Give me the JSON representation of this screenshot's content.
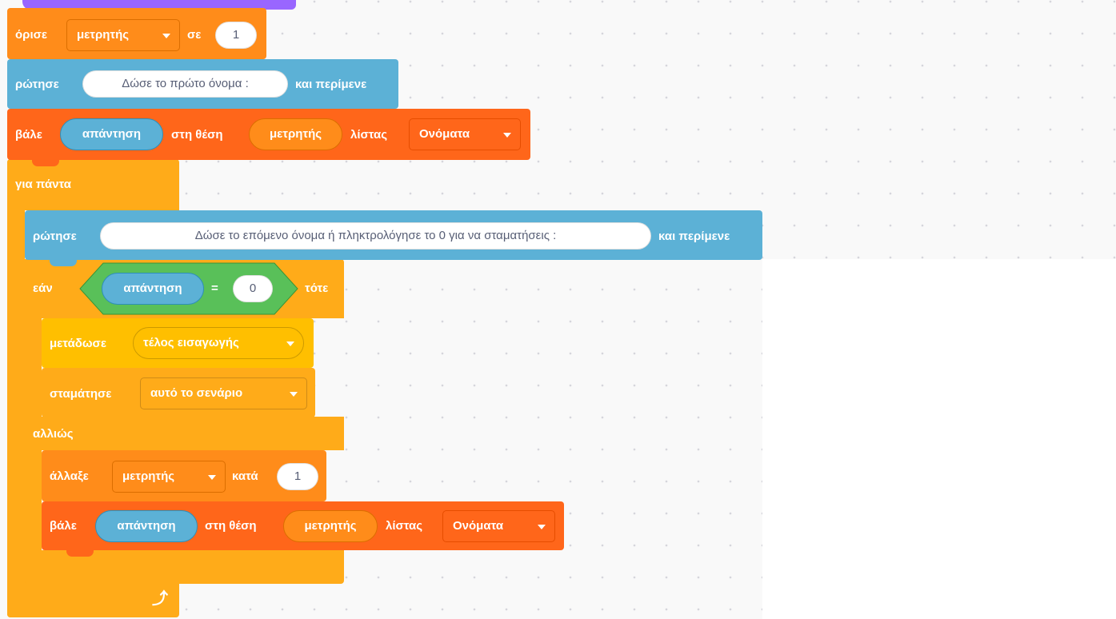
{
  "colors": {
    "variables": "#ff8c1a",
    "sensing": "#5cb1d6",
    "lists": "#ff661a",
    "control": "#ffab19",
    "events": "#ffbf00",
    "operators": "#59c059",
    "looks_hat": "#9966ff"
  },
  "set_block": {
    "label": "όρισε",
    "variable": "μετρητής",
    "to": "σε",
    "value": "1"
  },
  "ask1": {
    "label": "ρώτησε",
    "question": "Δώσε το πρώτο όνομα :",
    "suffix": "και περίμενε"
  },
  "insert1": {
    "label": "βάλε",
    "item": "απάντηση",
    "at": "στη θέση",
    "index": "μετρητής",
    "of_list": "λίστας",
    "list": "Ονόματα"
  },
  "forever": {
    "label": "για πάντα",
    "loop_icon": "loop-arrow-icon"
  },
  "ask2": {
    "label": "ρώτησε",
    "question": "Δώσε το επόμενο όνομα ή πληκτρολόγησε το 0 για να σταματήσεις :",
    "suffix": "και περίμενε"
  },
  "if_else": {
    "if_label": "εάν",
    "then_label": "τότε",
    "else_label": "αλλιώς",
    "condition": {
      "left": "απάντηση",
      "operator": "=",
      "right": "0"
    }
  },
  "broadcast": {
    "label": "μετάδωσε",
    "message": "τέλος εισαγωγής"
  },
  "stop": {
    "label": "σταμάτησε",
    "option": "αυτό το σενάριο"
  },
  "change": {
    "label": "άλλαξε",
    "variable": "μετρητής",
    "by": "κατά",
    "value": "1"
  },
  "insert2": {
    "label": "βάλε",
    "item": "απάντηση",
    "at": "στη θέση",
    "index": "μετρητής",
    "of_list": "λίστας",
    "list": "Ονόματα"
  }
}
